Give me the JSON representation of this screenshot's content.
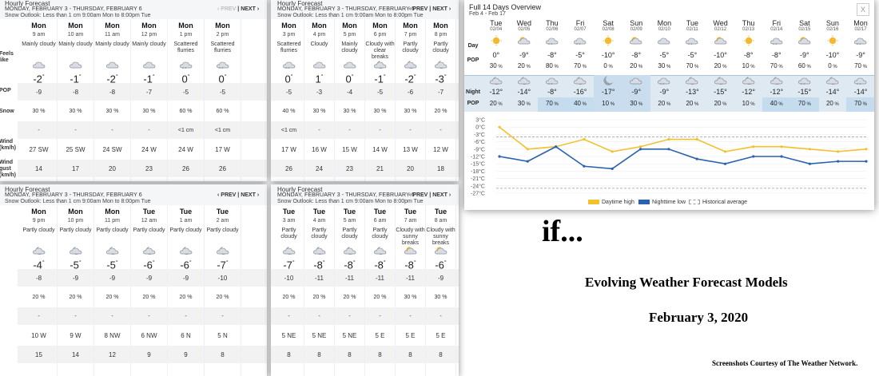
{
  "panels": [
    {
      "title": "Hourly Forecast",
      "range": "MONDAY, FEBRUARY 3 - THURSDAY, FEBRUARY 6",
      "snow": "Snow Outlook: Less than 1 cm 9:00am Mon to 8:00pm Tue",
      "prev": "‹ PREV",
      "next": "NEXT ›",
      "prev_disabled": true,
      "labels": [
        "Feels like",
        "POP",
        "Snow",
        "Wind (km/h)",
        "Wind gust (km/h)"
      ],
      "cols": [
        {
          "day": "Mon",
          "time": "9 am",
          "cond": "Mainly cloudy",
          "icon": "mainly-cloudy-icon",
          "temp": "-2",
          "feels": "-9",
          "pop": "30",
          "snow": "-",
          "wind": "27 SW",
          "gust": "14"
        },
        {
          "day": "Mon",
          "time": "10 am",
          "cond": "Mainly cloudy",
          "icon": "mainly-cloudy-icon",
          "temp": "-1",
          "feels": "-8",
          "pop": "30",
          "snow": "-",
          "wind": "25 SW",
          "gust": "17"
        },
        {
          "day": "Mon",
          "time": "11 am",
          "cond": "Mainly cloudy",
          "icon": "mainly-cloudy-icon",
          "temp": "-2",
          "feels": "-8",
          "pop": "30",
          "snow": "-",
          "wind": "24 SW",
          "gust": "20"
        },
        {
          "day": "Mon",
          "time": "12 pm",
          "cond": "Mainly cloudy",
          "icon": "mainly-cloudy-icon",
          "temp": "-1",
          "feels": "-7",
          "pop": "30",
          "snow": "-",
          "wind": "24 W",
          "gust": "23"
        },
        {
          "day": "Mon",
          "time": "1 pm",
          "cond": "Scattered flurries",
          "icon": "flurries-icon",
          "temp": "0",
          "feels": "-5",
          "pop": "60",
          "snow": "<1 cm",
          "wind": "24 W",
          "gust": "26"
        },
        {
          "day": "Mon",
          "time": "2 pm",
          "cond": "Scattered flurries",
          "icon": "flurries-icon",
          "temp": "0",
          "feels": "-5",
          "pop": "60",
          "snow": "<1 cm",
          "wind": "17 W",
          "gust": "26"
        }
      ]
    },
    {
      "title": "Hourly Forecast",
      "range": "MONDAY, FEBRUARY 3 - THURSDAY, FEBRUARY 6",
      "snow": "Snow Outlook: Less than 1 cm 9:00am Mon to 8:00pm Tue",
      "prev": "‹ PREV",
      "next": "NEXT ›",
      "prev_disabled": false,
      "labels": [],
      "cols": [
        {
          "day": "Mon",
          "time": "3 pm",
          "cond": "Scattered flurries",
          "icon": "flurries-icon",
          "temp": "0",
          "feels": "-5",
          "pop": "40",
          "snow": "<1 cm",
          "wind": "17 W",
          "gust": "26"
        },
        {
          "day": "Mon",
          "time": "4 pm",
          "cond": "Cloudy",
          "icon": "cloudy-icon",
          "temp": "1",
          "feels": "-3",
          "pop": "30",
          "snow": "-",
          "wind": "16 W",
          "gust": "24"
        },
        {
          "day": "Mon",
          "time": "5 pm",
          "cond": "Mainly cloudy",
          "icon": "mainly-cloudy-icon",
          "temp": "0",
          "feels": "-4",
          "pop": "30",
          "snow": "-",
          "wind": "15 W",
          "gust": "23"
        },
        {
          "day": "Mon",
          "time": "6 pm",
          "cond": "Cloudy with clear breaks",
          "icon": "clear-breaks-icon",
          "temp": "-1",
          "feels": "-5",
          "pop": "30",
          "snow": "-",
          "wind": "14 W",
          "gust": "21"
        },
        {
          "day": "Mon",
          "time": "7 pm",
          "cond": "Partly cloudy",
          "icon": "partly-cloudy-night-icon",
          "temp": "-2",
          "feels": "-6",
          "pop": "30",
          "snow": "-",
          "wind": "13 W",
          "gust": "20"
        },
        {
          "day": "Mon",
          "time": "8 pm",
          "cond": "Partly cloudy",
          "icon": "partly-cloudy-night-icon",
          "temp": "-3",
          "feels": "-7",
          "pop": "20",
          "snow": "-",
          "wind": "12 W",
          "gust": "18"
        }
      ]
    },
    {
      "title": "Hourly Forecast",
      "range": "MONDAY, FEBRUARY 3 - THURSDAY, FEBRUARY 6",
      "snow": "Snow Outlook: Less than 1 cm 9:00am Mon to 8:00pm Tue",
      "prev": "‹ PREV",
      "next": "NEXT ›",
      "prev_disabled": false,
      "labels": [],
      "cols": [
        {
          "day": "Mon",
          "time": "9 pm",
          "cond": "Partly cloudy",
          "icon": "partly-cloudy-night-icon",
          "temp": "-4",
          "feels": "-8",
          "pop": "20",
          "snow": "-",
          "wind": "10 W",
          "gust": "15"
        },
        {
          "day": "Mon",
          "time": "10 pm",
          "cond": "Partly cloudy",
          "icon": "partly-cloudy-night-icon",
          "temp": "-5",
          "feels": "-9",
          "pop": "20",
          "snow": "-",
          "wind": "9 W",
          "gust": "14"
        },
        {
          "day": "Mon",
          "time": "11 pm",
          "cond": "Partly cloudy",
          "icon": "partly-cloudy-night-icon",
          "temp": "-5",
          "feels": "-9",
          "pop": "20",
          "snow": "-",
          "wind": "8 NW",
          "gust": "12"
        },
        {
          "day": "Tue",
          "time": "12 am",
          "cond": "Partly cloudy",
          "icon": "partly-cloudy-night-icon",
          "temp": "-6",
          "feels": "-9",
          "pop": "20",
          "snow": "-",
          "wind": "6 NW",
          "gust": "9"
        },
        {
          "day": "Tue",
          "time": "1 am",
          "cond": "Partly cloudy",
          "icon": "partly-cloudy-night-icon",
          "temp": "-6",
          "feels": "-9",
          "pop": "20",
          "snow": "-",
          "wind": "6 N",
          "gust": "9"
        },
        {
          "day": "Tue",
          "time": "2 am",
          "cond": "Partly cloudy",
          "icon": "partly-cloudy-night-icon",
          "temp": "-7",
          "feels": "-10",
          "pop": "20",
          "snow": "-",
          "wind": "5 N",
          "gust": "8"
        }
      ]
    },
    {
      "title": "Hourly Forecast",
      "range": "MONDAY, FEBRUARY 3 - THURSDAY, FEBRUARY 6",
      "snow": "Snow Outlook: Less than 1 cm 9:00am Mon to 8:00pm Tue",
      "prev": "‹ PREV",
      "next": "NEXT ›",
      "prev_disabled": false,
      "labels": [],
      "cols": [
        {
          "day": "Tue",
          "time": "3 am",
          "cond": "Partly cloudy",
          "icon": "partly-cloudy-night-icon",
          "temp": "-7",
          "feels": "-10",
          "pop": "20",
          "snow": "-",
          "wind": "5 NE",
          "gust": "8"
        },
        {
          "day": "Tue",
          "time": "4 am",
          "cond": "Partly cloudy",
          "icon": "partly-cloudy-night-icon",
          "temp": "-8",
          "feels": "-11",
          "pop": "20",
          "snow": "-",
          "wind": "5 NE",
          "gust": "8"
        },
        {
          "day": "Tue",
          "time": "5 am",
          "cond": "Partly cloudy",
          "icon": "partly-cloudy-night-icon",
          "temp": "-8",
          "feels": "-11",
          "pop": "20",
          "snow": "-",
          "wind": "5 NE",
          "gust": "8"
        },
        {
          "day": "Tue",
          "time": "6 am",
          "cond": "Partly cloudy",
          "icon": "partly-cloudy-night-icon",
          "temp": "-8",
          "feels": "-11",
          "pop": "20",
          "snow": "-",
          "wind": "5 E",
          "gust": "8"
        },
        {
          "day": "Tue",
          "time": "7 am",
          "cond": "Cloudy with sunny breaks",
          "icon": "sunny-breaks-icon",
          "temp": "-8",
          "feels": "-11",
          "pop": "30",
          "snow": "-",
          "wind": "5 E",
          "gust": "8"
        },
        {
          "day": "Tue",
          "time": "8 am",
          "cond": "Cloudy with sunny breaks",
          "icon": "sunny-breaks-icon",
          "temp": "-6",
          "feels": "-9",
          "pop": "30",
          "snow": "-",
          "wind": "5 E",
          "gust": "8"
        }
      ]
    }
  ],
  "overview": {
    "title": "Full 14 Days Overview",
    "subtitle": "Feb 4 - Feb 17",
    "close": "X",
    "day_label": "Day",
    "pop_label": "POP",
    "night_label": "Night",
    "colors": {
      "high": "#f2c12e",
      "low": "#2a62b0",
      "night_band": "#dfe9f2",
      "night_pop_high": "#c5dcee",
      "avg": "#999999"
    },
    "days": [
      {
        "dn": "Tue",
        "dt": "02/04",
        "hi": "0",
        "pop": "30",
        "lo": "-12",
        "npop": "20",
        "di": "sun-icon",
        "ni": "partly-cloudy-night-icon"
      },
      {
        "dn": "Wed",
        "dt": "02/05",
        "hi": "-9",
        "pop": "20",
        "lo": "-14",
        "npop": "30",
        "di": "sunny-breaks-icon",
        "ni": "partly-cloudy-night-icon"
      },
      {
        "dn": "Thu",
        "dt": "02/06",
        "hi": "-8",
        "pop": "80",
        "lo": "-8",
        "npop": "70",
        "di": "flurries-icon",
        "ni": "flurries-icon"
      },
      {
        "dn": "Fri",
        "dt": "02/07",
        "hi": "-5",
        "pop": "70",
        "lo": "-16",
        "npop": "40",
        "di": "flurries-icon",
        "ni": "partly-cloudy-night-icon"
      },
      {
        "dn": "Sat",
        "dt": "02/08",
        "hi": "-10",
        "pop": "0",
        "lo": "-17",
        "npop": "10",
        "di": "sun-icon",
        "ni": "moon-icon"
      },
      {
        "dn": "Sun",
        "dt": "02/09",
        "hi": "-8",
        "pop": "20",
        "lo": "-9",
        "npop": "30",
        "di": "sunny-breaks-icon",
        "ni": "cloudy-icon"
      },
      {
        "dn": "Mon",
        "dt": "02/10",
        "hi": "-5",
        "pop": "30",
        "lo": "-9",
        "npop": "20",
        "di": "cloudy-icon",
        "ni": "flurries-icon"
      },
      {
        "dn": "Tue",
        "dt": "02/11",
        "hi": "-5",
        "pop": "70",
        "lo": "-13",
        "npop": "20",
        "di": "flurries-icon",
        "ni": "partly-cloudy-night-icon"
      },
      {
        "dn": "Wed",
        "dt": "02/12",
        "hi": "-10",
        "pop": "20",
        "lo": "-15",
        "npop": "20",
        "di": "sunny-breaks-icon",
        "ni": "partly-cloudy-night-icon"
      },
      {
        "dn": "Thu",
        "dt": "02/13",
        "hi": "-8",
        "pop": "10",
        "lo": "-12",
        "npop": "10",
        "di": "sun-icon",
        "ni": "partly-cloudy-night-icon"
      },
      {
        "dn": "Fri",
        "dt": "02/14",
        "hi": "-8",
        "pop": "70",
        "lo": "-12",
        "npop": "40",
        "di": "flurries-icon",
        "ni": "partly-cloudy-night-icon"
      },
      {
        "dn": "Sat",
        "dt": "02/15",
        "hi": "-9",
        "pop": "60",
        "lo": "-15",
        "npop": "70",
        "di": "sunny-breaks-icon",
        "ni": "flurries-icon"
      },
      {
        "dn": "Sun",
        "dt": "02/16",
        "hi": "-10",
        "pop": "0",
        "lo": "-14",
        "npop": "20",
        "di": "sun-icon",
        "ni": "partly-cloudy-night-icon"
      },
      {
        "dn": "Mon",
        "dt": "02/17",
        "hi": "-9",
        "pop": "70",
        "lo": "-14",
        "npop": "70",
        "di": "flurries-icon",
        "ni": "flurries-icon"
      }
    ]
  },
  "chart_data": {
    "type": "line",
    "title": "",
    "x": [
      "02/04",
      "02/05",
      "02/06",
      "02/07",
      "02/08",
      "02/09",
      "02/10",
      "02/11",
      "02/12",
      "02/13",
      "02/14",
      "02/15",
      "02/16",
      "02/17"
    ],
    "yticks": [
      "3°C",
      "0°C",
      "-3°C",
      "-6°C",
      "-9°C",
      "-12°C",
      "-15°C",
      "-18°C",
      "-21°C",
      "-24°C",
      "-27°C"
    ],
    "ylim": [
      -27,
      3
    ],
    "series": [
      {
        "name": "Daytime high",
        "values": [
          0,
          -9,
          -8,
          -5,
          -10,
          -8,
          -5,
          -5,
          -10,
          -8,
          -8,
          -9,
          -10,
          -9
        ]
      },
      {
        "name": "Nighttime low",
        "values": [
          -12,
          -14,
          -8,
          -16,
          -17,
          -9,
          -9,
          -13,
          -15,
          -12,
          -12,
          -15,
          -14,
          -14
        ]
      }
    ],
    "historical_average": {
      "name": "Historical average",
      "upper": -4,
      "lower": -25
    },
    "legend_position": "bottom"
  },
  "text": {
    "if": "if...",
    "title": "Evolving Weather Forecast Models",
    "date": "February 3, 2020",
    "credit": "Screenshots Courtesy of The Weather Network."
  }
}
